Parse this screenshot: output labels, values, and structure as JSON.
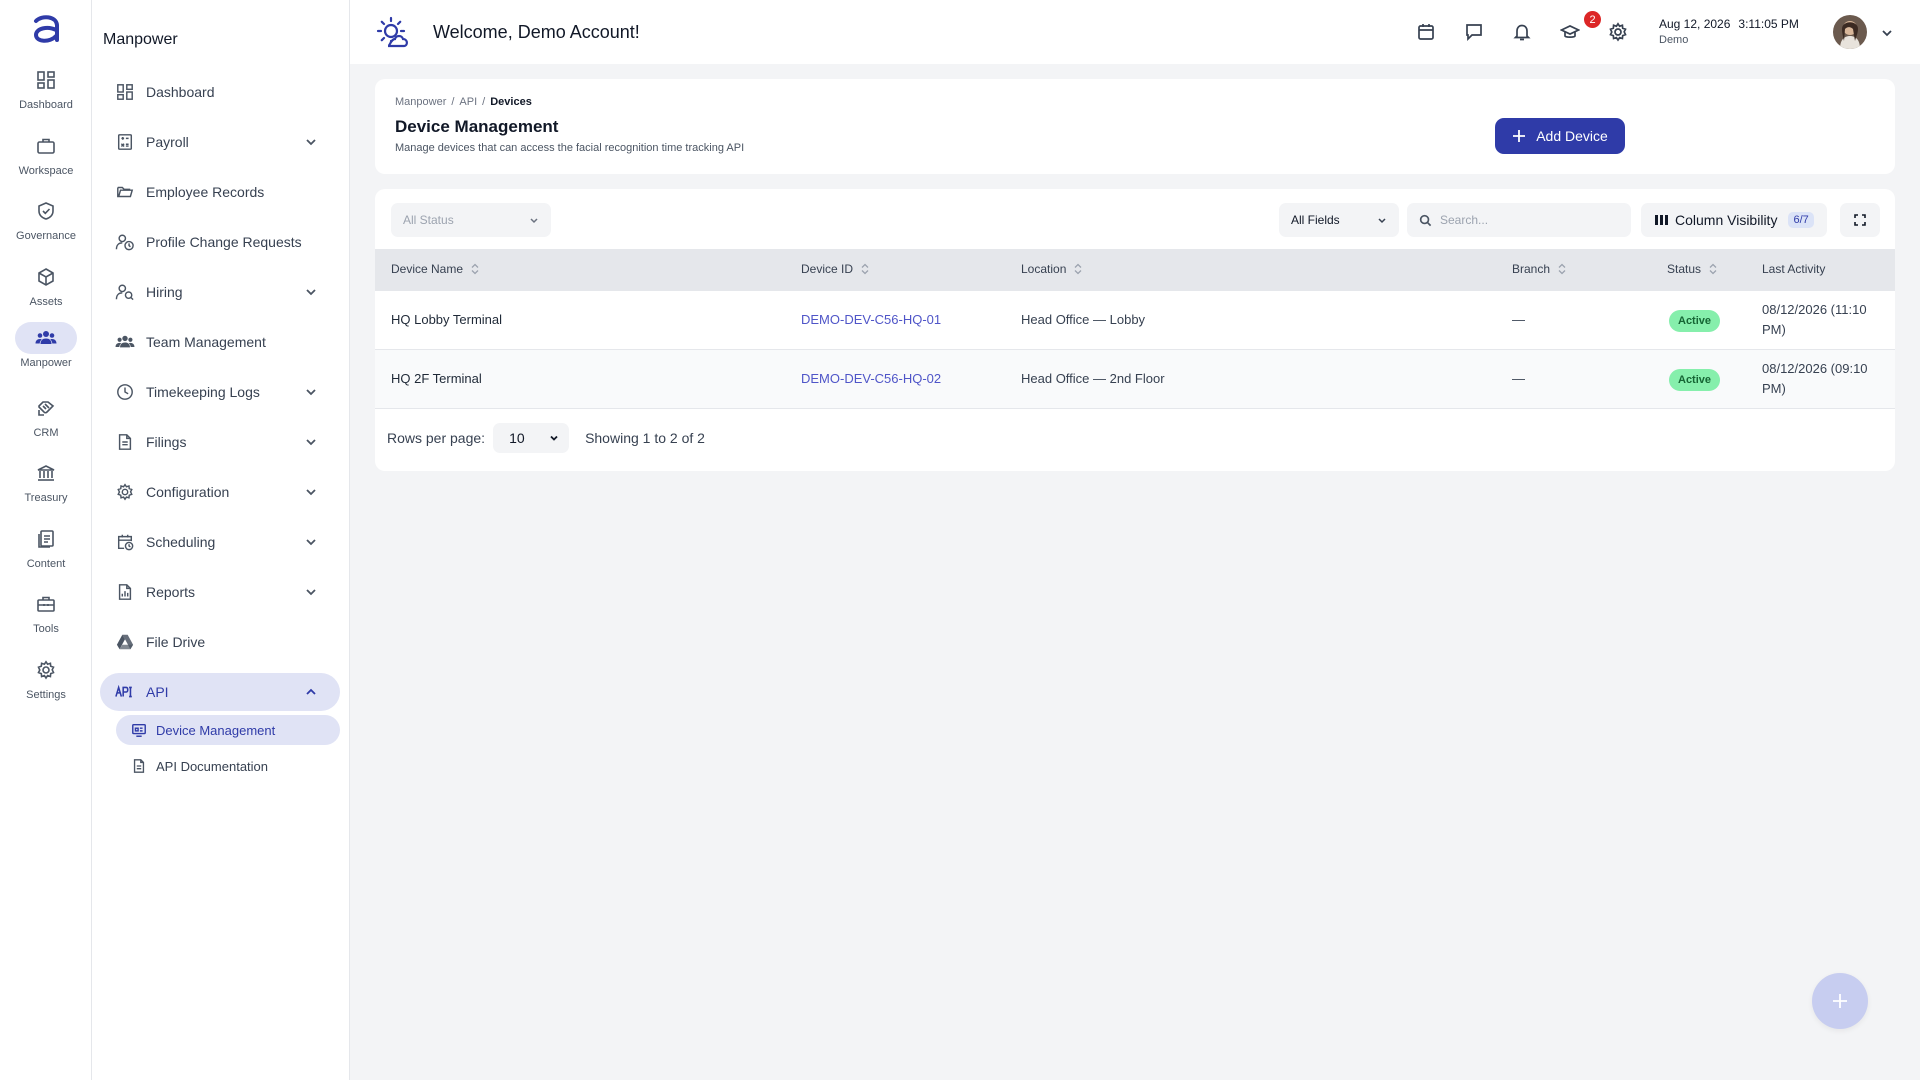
{
  "rail": {
    "items": [
      {
        "label": "Dashboard",
        "icon": "dashboard-icon"
      },
      {
        "label": "Workspace",
        "icon": "briefcase-icon"
      },
      {
        "label": "Governance",
        "icon": "shield-check-icon"
      },
      {
        "label": "Assets",
        "icon": "cube-icon"
      },
      {
        "label": "Manpower",
        "icon": "users-icon",
        "active": true
      },
      {
        "label": "CRM",
        "icon": "handshake-icon"
      },
      {
        "label": "Treasury",
        "icon": "bank-icon"
      },
      {
        "label": "Content",
        "icon": "document-icon"
      },
      {
        "label": "Tools",
        "icon": "toolbox-icon"
      },
      {
        "label": "Settings",
        "icon": "gear-icon"
      }
    ]
  },
  "sidebar": {
    "title": "Manpower",
    "items": [
      {
        "label": "Dashboard",
        "icon": "dashboard-icon",
        "expandable": false
      },
      {
        "label": "Payroll",
        "icon": "calculator-icon",
        "expandable": true
      },
      {
        "label": "Employee Records",
        "icon": "folder-open-icon",
        "expandable": false
      },
      {
        "label": "Profile Change Requests",
        "icon": "user-clock-icon",
        "expandable": false
      },
      {
        "label": "Hiring",
        "icon": "user-search-icon",
        "expandable": true
      },
      {
        "label": "Team Management",
        "icon": "team-icon",
        "expandable": false
      },
      {
        "label": "Timekeeping Logs",
        "icon": "clock-icon",
        "expandable": true
      },
      {
        "label": "Filings",
        "icon": "file-icon",
        "expandable": true
      },
      {
        "label": "Configuration",
        "icon": "gear-icon",
        "expandable": true
      },
      {
        "label": "Scheduling",
        "icon": "calendar-clock-icon",
        "expandable": true
      },
      {
        "label": "Reports",
        "icon": "report-icon",
        "expandable": true
      },
      {
        "label": "File Drive",
        "icon": "drive-icon",
        "expandable": false
      },
      {
        "label": "API",
        "icon": "api-icon",
        "expandable": true,
        "open": true
      }
    ],
    "api_sub": [
      {
        "label": "Device Management",
        "icon": "device-icon",
        "active": true
      },
      {
        "label": "API Documentation",
        "icon": "doc-icon",
        "active": false
      }
    ]
  },
  "header": {
    "welcome": "Welcome, Demo Account!",
    "notification_count": "2",
    "date": "Aug 12, 2026",
    "time": "3:11:05 PM",
    "user": "Demo"
  },
  "page": {
    "breadcrumb": [
      "Manpower",
      "API",
      "Devices"
    ],
    "title": "Device Management",
    "subtitle": "Manage devices that can access the facial recognition time tracking API",
    "add_button": "Add Device"
  },
  "toolbar": {
    "status_filter": "All Status",
    "field_filter": "All Fields",
    "search_placeholder": "Search...",
    "column_visibility": "Column Visibility",
    "column_count": "6/7"
  },
  "table": {
    "columns": [
      "Device Name",
      "Device ID",
      "Location",
      "Branch",
      "Status",
      "Last Activity"
    ],
    "rows": [
      {
        "name": "HQ Lobby Terminal",
        "device_id": "DEMO-DEV-C56-HQ-01",
        "location": "Head Office — Lobby",
        "branch": "—",
        "status": "Active",
        "last_activity": "08/12/2026 (11:10 PM)"
      },
      {
        "name": "HQ 2F Terminal",
        "device_id": "DEMO-DEV-C56-HQ-02",
        "location": "Head Office — 2nd Floor",
        "branch": "—",
        "status": "Active",
        "last_activity": "08/12/2026 (09:10 PM)"
      }
    ]
  },
  "pagination": {
    "rows_label": "Rows per page:",
    "rows_value": "10",
    "showing": "Showing 1 to 2 of 2"
  },
  "colors": {
    "accent": "#2f3ba8",
    "active_bg": "#e0e3f5",
    "status_active": "#86efac",
    "link": "#4f55c8"
  }
}
